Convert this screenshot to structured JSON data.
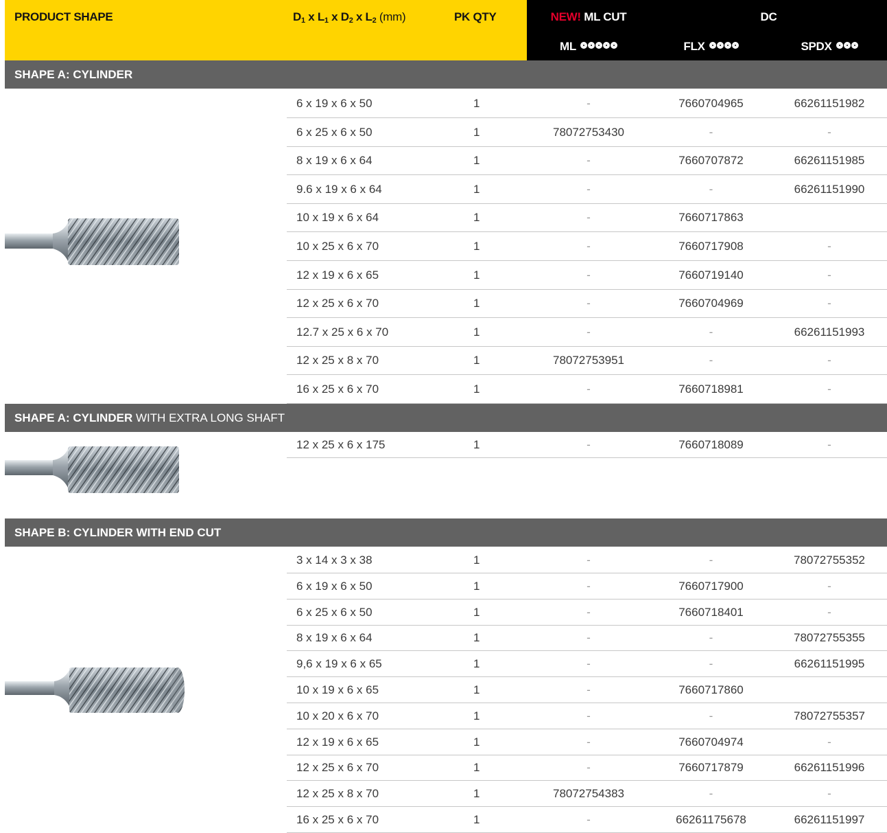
{
  "header": {
    "product_shape": "PRODUCT SHAPE",
    "dims_prefix": "D",
    "pk_qty": "PK QTY",
    "new_label": "NEW!",
    "ml_cut": "ML CUT",
    "dc": "DC",
    "ml": "ML",
    "flx": "FLX",
    "spdx": "SPDX",
    "ml_dots": 5,
    "flx_dots": 4,
    "spdx_dots": 3
  },
  "sections": [
    {
      "title_bold": "SHAPE A: CYLINDER",
      "title_rest": "",
      "rows": [
        {
          "dim": "6 x 19 x 6 x 50",
          "qty": "1",
          "ml": "-",
          "flx": "7660704965",
          "spdx": "66261151982"
        },
        {
          "dim": "6 x 25 x 6 x 50",
          "qty": "1",
          "ml": "78072753430",
          "flx": "-",
          "spdx": "-"
        },
        {
          "dim": "8 x 19 x 6 x 64",
          "qty": "1",
          "ml": "-",
          "flx": "7660707872",
          "spdx": "66261151985"
        },
        {
          "dim": "9.6 x 19 x 6 x 64",
          "qty": "1",
          "ml": "-",
          "flx": "-",
          "spdx": "66261151990"
        },
        {
          "dim": "10 x 19 x 6 x 64",
          "qty": "1",
          "ml": "-",
          "flx": "7660717863",
          "spdx": ""
        },
        {
          "dim": "10 x 25 x 6 x 70",
          "qty": "1",
          "ml": "-",
          "flx": "7660717908",
          "spdx": "-"
        },
        {
          "dim": "12 x 19 x 6 x 65",
          "qty": "1",
          "ml": "-",
          "flx": "7660719140",
          "spdx": "-"
        },
        {
          "dim": "12 x 25 x 6 x 70",
          "qty": "1",
          "ml": "-",
          "flx": "7660704969",
          "spdx": "-"
        },
        {
          "dim": "12.7 x 25 x 6 x 70",
          "qty": "1",
          "ml": "-",
          "flx": "-",
          "spdx": "66261151993"
        },
        {
          "dim": "12 x 25 x 8 x 70",
          "qty": "1",
          "ml": "78072753951",
          "flx": "-",
          "spdx": "-"
        },
        {
          "dim": "16 x 25 x 6 x 70",
          "qty": "1",
          "ml": "-",
          "flx": "7660718981",
          "spdx": "-"
        }
      ]
    },
    {
      "title_bold": "SHAPE A: CYLINDER",
      "title_rest": " WITH EXTRA LONG SHAFT",
      "rows": [
        {
          "dim": "12 x 25 x 6 x 175",
          "qty": "1",
          "ml": "-",
          "flx": "7660718089",
          "spdx": "-"
        }
      ]
    },
    {
      "title_bold": "SHAPE B: CYLINDER WITH END CUT",
      "title_rest": "",
      "rows": [
        {
          "dim": "3 x 14 x 3 x 38",
          "qty": "1",
          "ml": "-",
          "flx": "-",
          "spdx": "78072755352"
        },
        {
          "dim": "6 x 19 x 6 x 50",
          "qty": "1",
          "ml": "-",
          "flx": "7660717900",
          "spdx": "-"
        },
        {
          "dim": "6 x 25 x 6 x 50",
          "qty": "1",
          "ml": "-",
          "flx": "7660718401",
          "spdx": "-"
        },
        {
          "dim": "8 x 19 x 6 x 64",
          "qty": "1",
          "ml": "-",
          "flx": "-",
          "spdx": "78072755355"
        },
        {
          "dim": "9,6 x 19 x 6 x 65",
          "qty": "1",
          "ml": "-",
          "flx": "-",
          "spdx": "66261151995"
        },
        {
          "dim": "10 x 19 x 6 x 65",
          "qty": "1",
          "ml": "-",
          "flx": "7660717860",
          "spdx": ""
        },
        {
          "dim": "10 x 20 x 6 x 70",
          "qty": "1",
          "ml": "-",
          "flx": "-",
          "spdx": "78072755357"
        },
        {
          "dim": "12 x 19 x 6 x 65",
          "qty": "1",
          "ml": "-",
          "flx": "7660704974",
          "spdx": "-"
        },
        {
          "dim": "12 x 25 x 6 x 70",
          "qty": "1",
          "ml": "-",
          "flx": "7660717879",
          "spdx": "66261151996"
        },
        {
          "dim": "12 x 25 x 8 x 70",
          "qty": "1",
          "ml": "78072754383",
          "flx": "-",
          "spdx": "-"
        },
        {
          "dim": "16 x 25 x 6 x 70",
          "qty": "1",
          "ml": "-",
          "flx": "66261175678",
          "spdx": "66261151997"
        }
      ]
    }
  ]
}
